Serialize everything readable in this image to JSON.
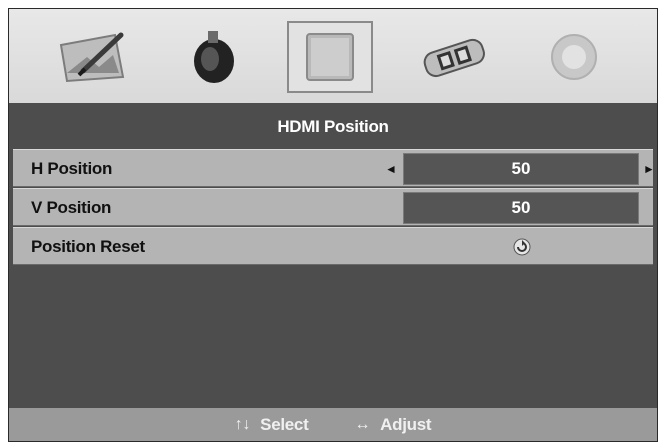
{
  "icons": [
    {
      "name": "picture-icon",
      "selected": false
    },
    {
      "name": "sound-icon",
      "selected": false
    },
    {
      "name": "screen-position-icon",
      "selected": true
    },
    {
      "name": "setup-icon",
      "selected": false
    },
    {
      "name": "option-icon",
      "selected": false
    }
  ],
  "menu": {
    "title": "HDMI Position",
    "rows": [
      {
        "label": "H Position",
        "value": "50",
        "left_arrow": "◄",
        "right_arrow": "►"
      },
      {
        "label": "V Position",
        "value": "50"
      },
      {
        "label": "Position Reset",
        "icon": "reset-icon"
      }
    ]
  },
  "footer": {
    "select_keys": "↑↓",
    "select_label": "Select",
    "adjust_keys": "↔",
    "adjust_label": "Adjust"
  }
}
